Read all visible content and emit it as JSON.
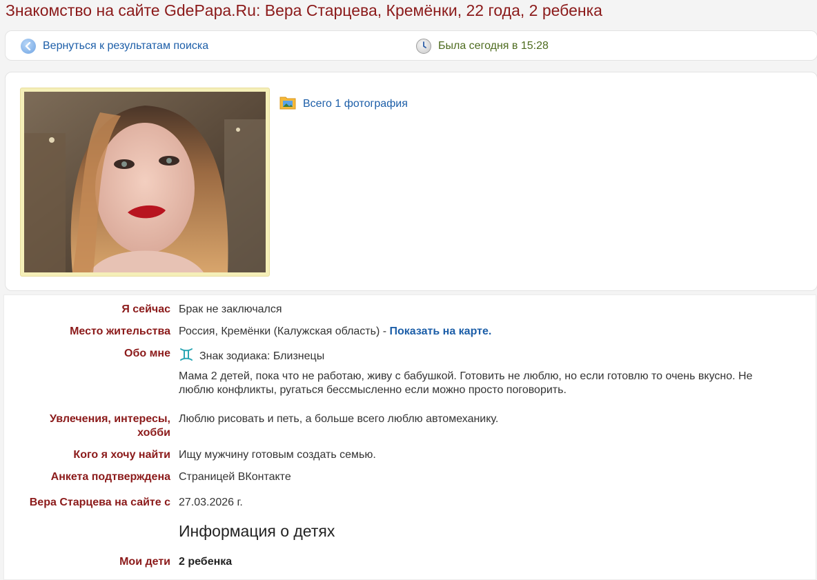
{
  "page": {
    "title": "Знакомство на сайте GdePapa.Ru: Вера Старцева, Кремёнки, 22 года, 2 ребенка"
  },
  "nav": {
    "back_label": "Вернуться к результатам поиска",
    "last_seen": "Была сегодня в 15:28"
  },
  "photos": {
    "album_label": "Всего 1 фотография"
  },
  "profile": {
    "status": {
      "label": "Я сейчас",
      "value": "Брак не заключался"
    },
    "location": {
      "label": "Место жительства",
      "value": "Россия, Кремёнки (Калужская область) - ",
      "map_link": "Показать на карте."
    },
    "about": {
      "label": "Обо мне",
      "zodiac": "Знак зодиака: Близнецы",
      "text": "Мама 2 детей, пока что не работаю, живу с бабушкой. Готовить не люблю, но если готовлю то очень вкусно. Не люблю конфликты, ругаться бессмысленно если можно просто поговорить."
    },
    "hobbies": {
      "label_line1": "Увлечения, интересы,",
      "label_line2": "хобби",
      "value": "Люблю рисовать и петь, а больше всего люблю автомеханику."
    },
    "seeking": {
      "label": "Кого я хочу найти",
      "value": "Ищу мужчину готовым создать семью."
    },
    "verified": {
      "label": "Анкета подтверждена",
      "value": "Страницей ВКонтакте"
    },
    "member_since": {
      "label": "Вера Старцева на сайте с",
      "value": "27.03.2026 г."
    }
  },
  "children": {
    "section_title": "Информация о детях",
    "label": "Мои дети",
    "value": "2 ребенка"
  },
  "colors": {
    "label_red": "#8b1a1a",
    "link_blue": "#1c5ea8",
    "status_green": "#4d6b1e",
    "photo_frame": "#f5efb8"
  },
  "icons": [
    "chevron-left-icon",
    "clock-icon",
    "photo-folder-icon",
    "gemini-zodiac-icon"
  ]
}
